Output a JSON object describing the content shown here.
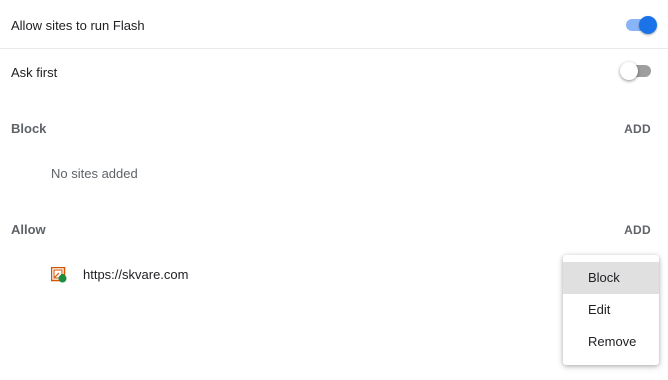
{
  "flash_setting": {
    "label": "Allow sites to run Flash",
    "enabled": true
  },
  "ask_first": {
    "label": "Ask first",
    "enabled": false
  },
  "block_section": {
    "heading": "Block",
    "add_label": "ADD",
    "empty_text": "No sites added"
  },
  "allow_section": {
    "heading": "Allow",
    "add_label": "ADD",
    "sites": [
      {
        "url": "https://skvare.com",
        "favicon": "skvare-favicon-icon"
      }
    ]
  },
  "context_menu": {
    "items": [
      {
        "label": "Block",
        "highlighted": true
      },
      {
        "label": "Edit",
        "highlighted": false
      },
      {
        "label": "Remove",
        "highlighted": false
      }
    ]
  },
  "colors": {
    "toggle_on_knob": "#1a73e8",
    "toggle_on_track": "#8ab4f8",
    "toggle_off_track": "#9e9e9e",
    "section_heading": "#5f6368",
    "menu_highlight": "#e0e0e0"
  }
}
